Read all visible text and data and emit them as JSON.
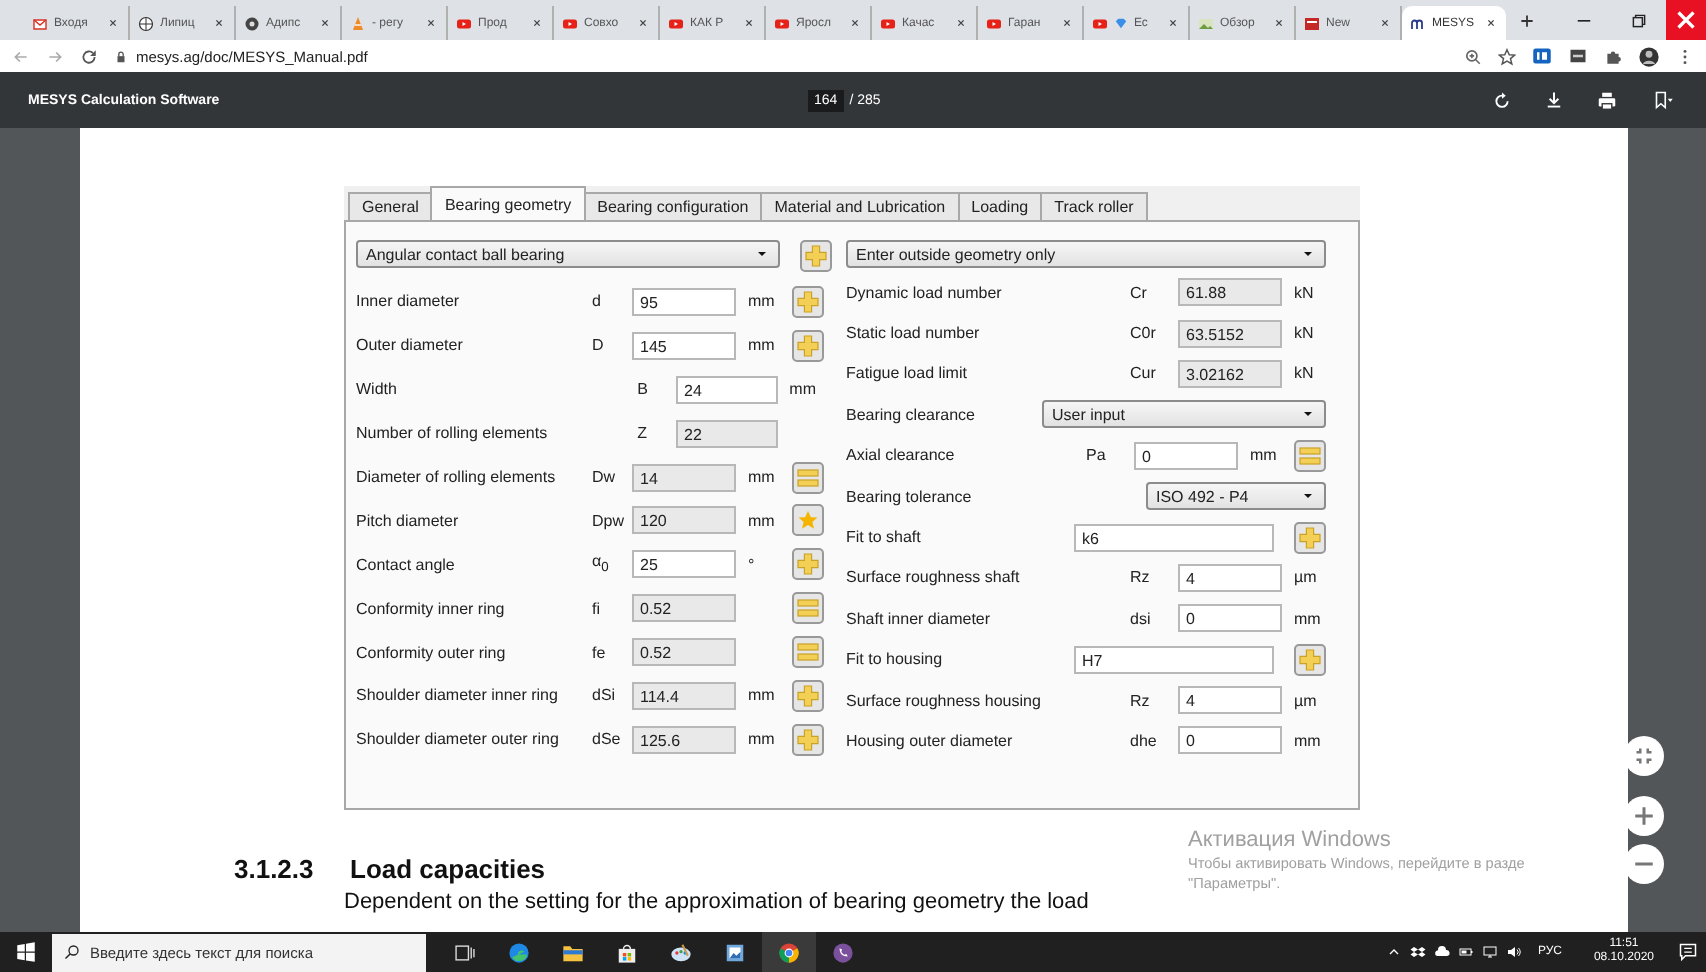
{
  "browser": {
    "tabs": [
      {
        "title": "Входя",
        "kind": "mail",
        "selected": false
      },
      {
        "title": "Липиц",
        "kind": "wiki",
        "selected": false
      },
      {
        "title": "Адипс",
        "kind": "flower",
        "selected": false
      },
      {
        "title": "- регу",
        "kind": "cone",
        "selected": false
      },
      {
        "title": "Прод",
        "kind": "video",
        "selected": false
      },
      {
        "title": "Совхо",
        "kind": "video",
        "selected": false
      },
      {
        "title": "КАК Р",
        "kind": "video",
        "selected": false
      },
      {
        "title": "Яросл",
        "kind": "video",
        "selected": false
      },
      {
        "title": "Качас",
        "kind": "video",
        "selected": false
      },
      {
        "title": "Гаран",
        "kind": "video",
        "selected": false
      },
      {
        "title": "Ес",
        "kind": "video-gem",
        "selected": false
      },
      {
        "title": "Обзор",
        "kind": "image",
        "selected": false
      },
      {
        "title": "New",
        "kind": "news",
        "selected": false
      },
      {
        "title": "MESYS",
        "kind": "logo",
        "selected": true
      }
    ],
    "address": "mesys.ag/doc/MESYS_Manual.pdf"
  },
  "pdf_toolbar": {
    "title": "MESYS Calculation Software",
    "page": "164",
    "page_count": "/ 285"
  },
  "dialog": {
    "tabs": [
      {
        "label": "General",
        "selected": false
      },
      {
        "label": "Bearing geometry",
        "selected": true
      },
      {
        "label": "Bearing configuration",
        "selected": false
      },
      {
        "label": "Material and Lubrication",
        "selected": false
      },
      {
        "label": "Loading",
        "selected": false
      },
      {
        "label": "Track roller",
        "selected": false
      }
    ],
    "left": {
      "select": "Angular contact ball bearing",
      "rows": [
        {
          "kind": "field",
          "label": "Inner diameter",
          "symbol": "d",
          "value": "95",
          "unit": "mm",
          "editable": true,
          "button": {
            "kind": "plus"
          }
        },
        {
          "kind": "field",
          "label": "Outer diameter",
          "symbol": "D",
          "value": "145",
          "unit": "mm",
          "editable": true,
          "button": {
            "kind": "plus"
          }
        },
        {
          "kind": "offset",
          "label": "Width",
          "symbol": "B",
          "value": "24",
          "unit": "mm",
          "editable": true
        },
        {
          "kind": "offset",
          "label": "Number of rolling elements",
          "symbol": "Z",
          "value": "22",
          "editable": false
        },
        {
          "kind": "field",
          "label": "Diameter of rolling elements",
          "symbol": "Dw",
          "value": "14",
          "unit": "mm",
          "editable": false,
          "button": {
            "kind": "equal"
          }
        },
        {
          "kind": "field",
          "label": "Pitch diameter",
          "symbol": "Dpw",
          "value": "120",
          "unit": "mm",
          "editable": false,
          "button": {
            "kind": "star"
          }
        },
        {
          "kind": "field",
          "label": "Contact angle",
          "symbol": "α$_{0}$",
          "value": "25",
          "unit": "°",
          "editable": true,
          "button": {
            "kind": "plus"
          }
        },
        {
          "kind": "field",
          "label": "Conformity inner ring",
          "symbol": "fi",
          "value": "0.52",
          "editable": false,
          "button": {
            "kind": "equal"
          }
        },
        {
          "kind": "field",
          "label": "Conformity outer ring",
          "symbol": "fe",
          "value": "0.52",
          "editable": false,
          "button": {
            "kind": "equal"
          }
        },
        {
          "kind": "field",
          "label": "Shoulder diameter inner ring",
          "symbol": "dSi",
          "value": "114.4",
          "unit": "mm",
          "editable": false,
          "button": {
            "kind": "plus"
          }
        },
        {
          "kind": "field",
          "label": "Shoulder diameter outer ring",
          "symbol": "dSe",
          "value": "125.6",
          "unit": "mm",
          "editable": false,
          "button": {
            "kind": "plus"
          }
        }
      ]
    },
    "right": {
      "select": "Enter outside geometry only",
      "rows": [
        {
          "kind": "field",
          "label": "Dynamic load number",
          "symbol": "Cr",
          "value": "61.88",
          "unit": "kN",
          "editable": false
        },
        {
          "kind": "field",
          "label": "Static load number",
          "symbol": "C0r",
          "value": "63.5152",
          "unit": "kN",
          "editable": false
        },
        {
          "kind": "field",
          "label": "Fatigue load limit",
          "symbol": "Cur",
          "value": "3.02162",
          "unit": "kN",
          "editable": false
        },
        {
          "kind": "select",
          "label": "Bearing clearance",
          "value": "User input"
        },
        {
          "kind": "field",
          "label": "Axial clearance",
          "symbol": "Pa",
          "value": "0",
          "unit": "mm",
          "editable": true,
          "button": {
            "kind": "equal"
          }
        },
        {
          "kind": "select",
          "label": "Bearing tolerance",
          "value": "ISO 492 - P4"
        },
        {
          "kind": "fit",
          "label": "Fit to shaft",
          "value": "k6",
          "button": {
            "kind": "plus"
          }
        },
        {
          "kind": "field",
          "label": "Surface roughness shaft",
          "symbol": "Rz",
          "value": "4",
          "unit": "µm",
          "editable": true
        },
        {
          "kind": "field",
          "label": "Shaft inner diameter",
          "symbol": "dsi",
          "value": "0",
          "unit": "mm",
          "editable": true
        },
        {
          "kind": "fit",
          "label": "Fit to housing",
          "value": "H7",
          "button": {
            "kind": "plus"
          }
        },
        {
          "kind": "field",
          "label": "Surface roughness housing",
          "symbol": "Rz",
          "value": "4",
          "unit": "µm",
          "editable": true
        },
        {
          "kind": "field",
          "label": "Housing outer diameter",
          "symbol": "dhe",
          "value": "0",
          "unit": "mm",
          "editable": true
        }
      ]
    }
  },
  "document": {
    "section_number": "3.1.2.3",
    "section_title": "Load capacities",
    "paragraph": "Dependent on the setting for the approximation of bearing geometry the load"
  },
  "activation_notice": {
    "title": "Активация Windows",
    "lines": [
      "Чтобы активировать Windows, перейдите в разде",
      "\"Параметры\"."
    ]
  },
  "taskbar": {
    "search": {
      "placeholder": "Введите здесь текст для поиска"
    },
    "apps": [
      {
        "kind": "taskview",
        "active": false
      },
      {
        "kind": "edge",
        "active": false
      },
      {
        "kind": "folder",
        "active": false
      },
      {
        "kind": "store",
        "active": false
      },
      {
        "kind": "paint",
        "active": false
      },
      {
        "kind": "photos",
        "active": false
      },
      {
        "kind": "chrome",
        "active": true
      },
      {
        "kind": "viber",
        "active": false
      }
    ],
    "language": "РУС",
    "time": "11:51",
    "date": "08.10.2020"
  }
}
